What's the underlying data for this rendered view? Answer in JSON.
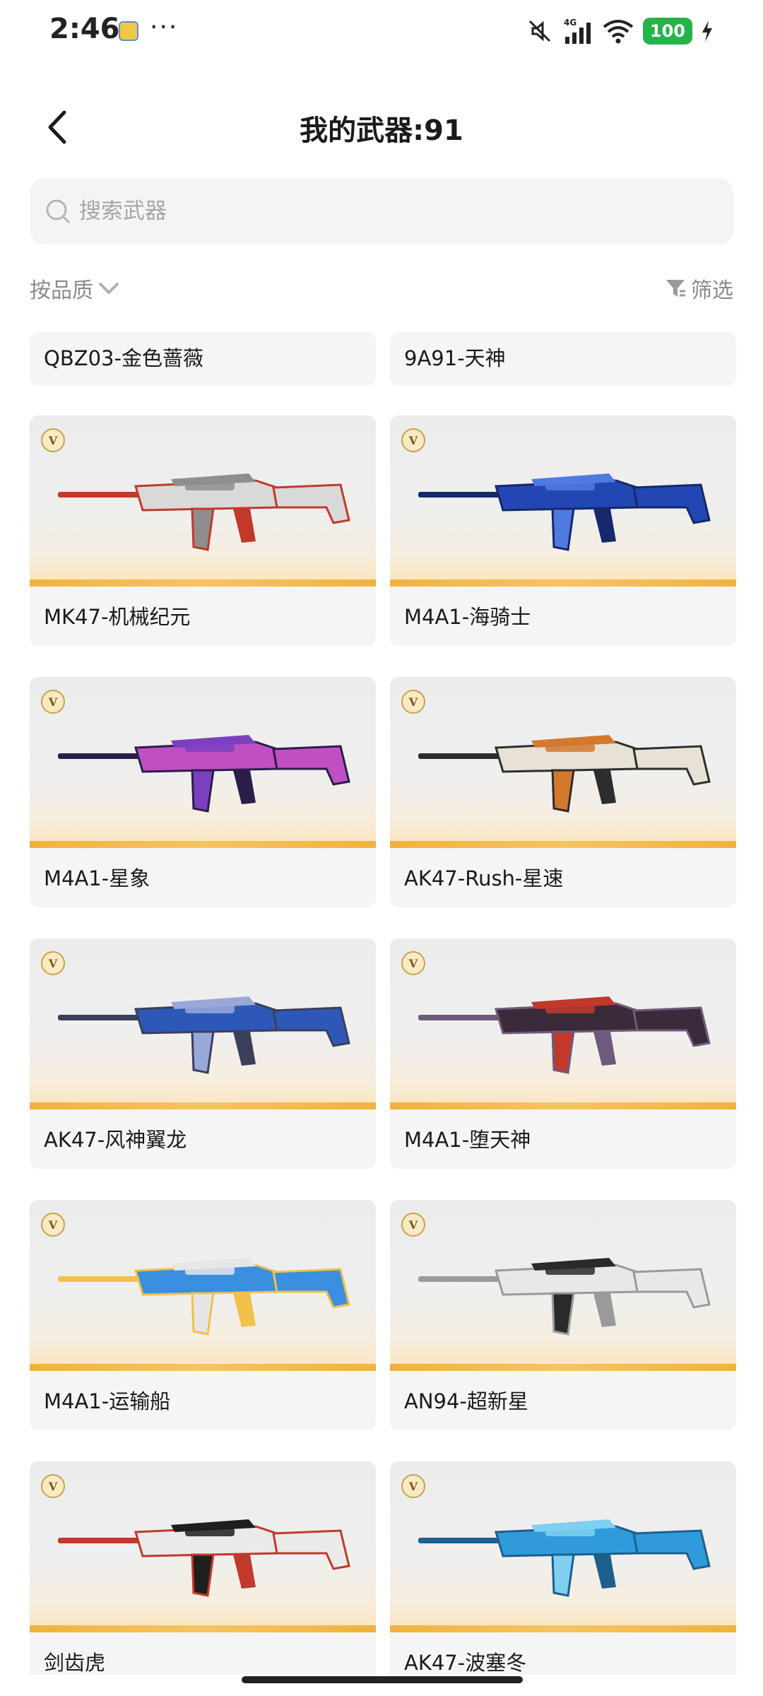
{
  "status_bar": {
    "time": "2:46",
    "dots": "···",
    "network": "4G",
    "battery": "100"
  },
  "header": {
    "title": "我的武器:91"
  },
  "search": {
    "placeholder": "搜索武器"
  },
  "sort": {
    "label": "按品质",
    "filter_label": "筛选"
  },
  "partial_top_row": [
    {
      "name": "QBZ03-金色蔷薇"
    },
    {
      "name": "9A91-天神"
    }
  ],
  "weapons": [
    {
      "name": "MK47-机械纪元",
      "badge": "V",
      "colors": [
        "#d9d9d9",
        "#8e8e8e",
        "#c0392b"
      ]
    },
    {
      "name": "M4A1-海骑士",
      "badge": "V",
      "colors": [
        "#2346b5",
        "#4f7be0",
        "#16286b"
      ]
    },
    {
      "name": "M4A1-星象",
      "badge": "V",
      "colors": [
        "#c04fc4",
        "#7b3fbf",
        "#2b1d4a"
      ]
    },
    {
      "name": "AK47-Rush-星速",
      "badge": "V",
      "colors": [
        "#e8e1d6",
        "#d4782e",
        "#2d2d2d"
      ]
    },
    {
      "name": "AK47-风神翼龙",
      "badge": "V",
      "colors": [
        "#2d58b8",
        "#9aa8d8",
        "#3a3f5c"
      ]
    },
    {
      "name": "M4A1-堕天神",
      "badge": "V",
      "colors": [
        "#3a2a3a",
        "#c0392b",
        "#6e5a7a"
      ]
    },
    {
      "name": "M4A1-运输船",
      "badge": "V",
      "colors": [
        "#3b8fe0",
        "#e6e6e6",
        "#f0c14b"
      ]
    },
    {
      "name": "AN94-超新星",
      "badge": "V",
      "colors": [
        "#e8e8e8",
        "#2a2a2a",
        "#9a9a9a"
      ]
    },
    {
      "name": "剑齿虎",
      "badge": "V",
      "colors": [
        "#eaeaea",
        "#1f1f1f",
        "#c0392b"
      ]
    },
    {
      "name": "AK47-波塞冬",
      "badge": "V",
      "colors": [
        "#2f9bdb",
        "#7fd0f0",
        "#1d5f8f"
      ]
    }
  ]
}
